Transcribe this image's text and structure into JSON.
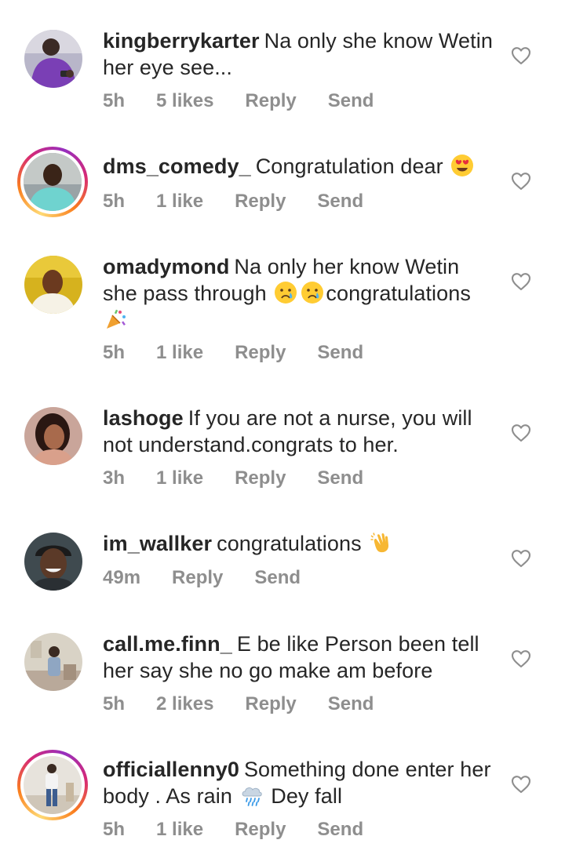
{
  "comments": [
    {
      "username": "kingberrykarter",
      "text_lines": [
        "Na only she know Wetin",
        "her eye see..."
      ],
      "time": "5h",
      "likes": "5 likes",
      "reply": "Reply",
      "send": "Send",
      "avatar_icon": "avatar-purple-shirt"
    },
    {
      "username": "dms_comedy_",
      "text_before_emoji": "Congratulation dear",
      "emoji": "heart-eyes-emoji",
      "time": "5h",
      "likes": "1 like",
      "reply": "Reply",
      "send": "Send",
      "avatar_icon": "avatar-teal-shirt"
    },
    {
      "username": "omadymond",
      "text_line1": "Na only her know Wetin",
      "text_line2_before": "she pass through",
      "emoji_a": "crying-face-emoji",
      "emoji_b": "crying-face-emoji",
      "text_line2_after": "congratulations",
      "emoji_c": "party-popper-emoji",
      "time": "5h",
      "likes": "1 like",
      "reply": "Reply",
      "send": "Send",
      "avatar_icon": "avatar-yellow"
    },
    {
      "username": "lashoge",
      "text_lines": [
        "If you are not a nurse, you will",
        "not understand.congrats to her."
      ],
      "time": "3h",
      "likes": "1 like",
      "reply": "Reply",
      "send": "Send",
      "avatar_icon": "avatar-woman"
    },
    {
      "username": "im_wallker",
      "text_before_emoji": "congratulations",
      "emoji": "clapping-hands-emoji",
      "time": "49m",
      "reply": "Reply",
      "send": "Send",
      "avatar_icon": "avatar-man-smiling"
    },
    {
      "username": "call.me.finn_",
      "text_lines": [
        "E be like Person been tell",
        "her say she no go make am before"
      ],
      "time": "5h",
      "likes": "2 likes",
      "reply": "Reply",
      "send": "Send",
      "avatar_icon": "avatar-room"
    },
    {
      "username": "officiallenny0",
      "text_line1": "Something done enter her",
      "text_line2_before": "body . As rain",
      "emoji": "rain-cloud-emoji",
      "text_line2_after": "Dey fall",
      "time": "5h",
      "likes": "1 like",
      "reply": "Reply",
      "send": "Send",
      "avatar_icon": "avatar-standing-person"
    }
  ],
  "colors": {
    "text": "#262626",
    "meta": "#8e8e8e",
    "heart_stroke": "#8e8e8e"
  }
}
